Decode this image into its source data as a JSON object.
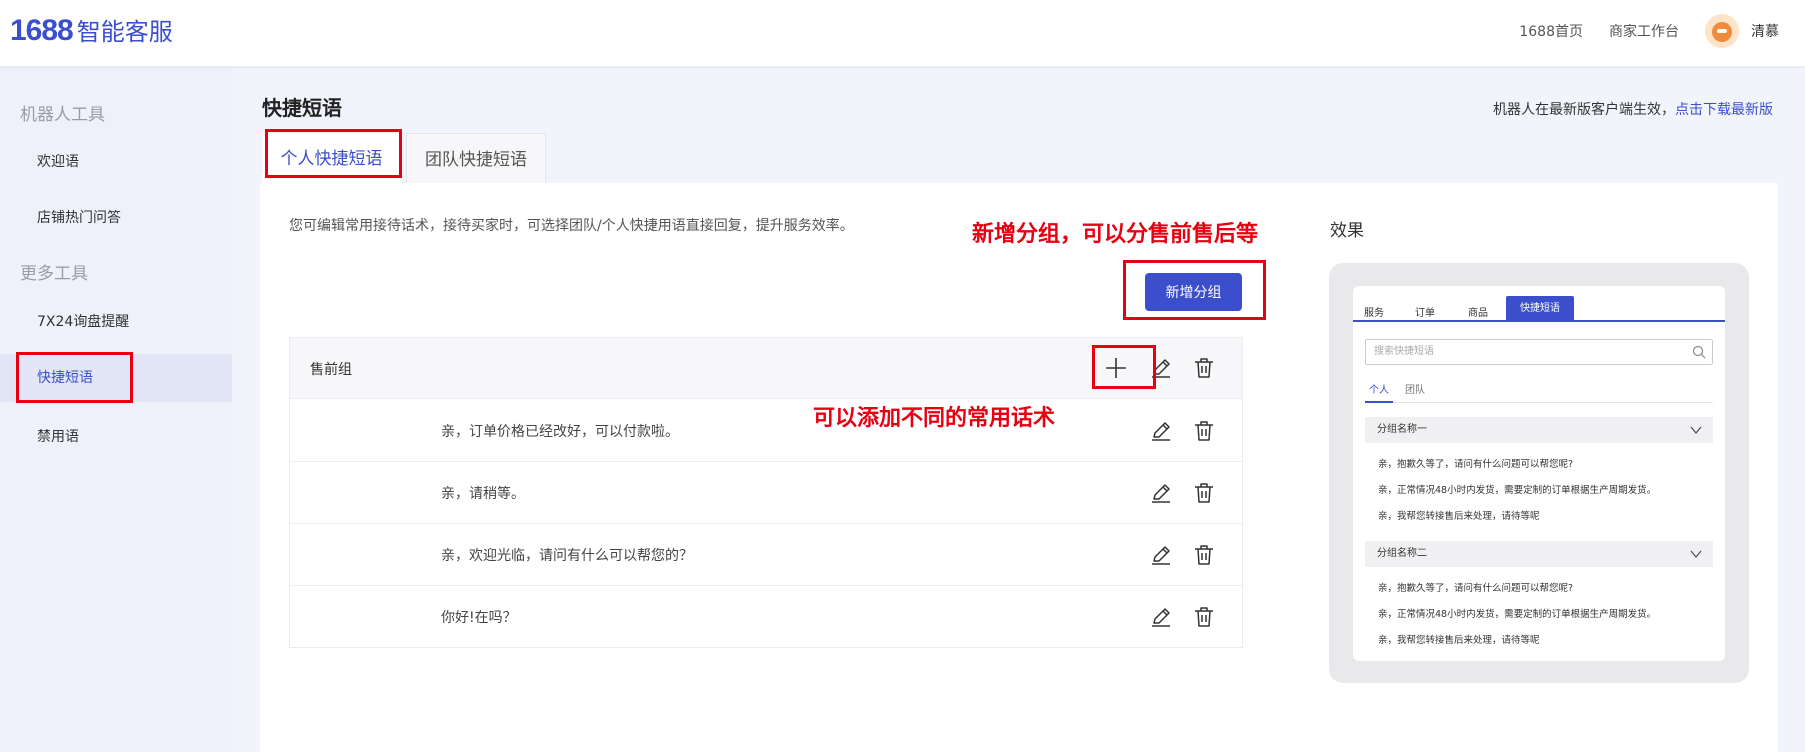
{
  "header": {
    "logo_num": "1688",
    "logo_text": "智能客服",
    "nav": [
      "1688首页",
      "商家工作台"
    ],
    "user_name": "清慕"
  },
  "sidebar": {
    "group1": "机器人工具",
    "group2": "更多工具",
    "items": [
      "欢迎语",
      "店铺热门问答",
      "7X24询盘提醒",
      "快捷短语",
      "禁用语"
    ]
  },
  "main": {
    "title": "快捷短语",
    "notice_text": "机器人在最新版客户端生效，",
    "notice_link": "点击下载最新版",
    "tabs": [
      "个人快捷短语",
      "团队快捷短语"
    ],
    "description": "您可编辑常用接待话术，接待买家时，可选择团队/个人快捷用语直接回复，提升服务效率。",
    "add_group_button": "新增分组",
    "group_name": "售前组",
    "rows": [
      "亲，订单价格已经改好，可以付款啦。",
      "亲，请稍等。",
      "亲，欢迎光临，请问有什么可以帮您的？",
      "你好!在吗？"
    ]
  },
  "preview": {
    "label": "效果",
    "tabs": [
      "服务",
      "订单",
      "商品",
      "快捷短语"
    ],
    "search_placeholder": "搜索快捷短语",
    "subtabs": [
      "个人",
      "团队"
    ],
    "group1": "分组名称一",
    "group1_items": [
      "亲，抱歉久等了，请问有什么问题可以帮您呢?",
      "亲，正常情况48小时内发货，需要定制的订单根据生产周期发货。",
      "亲，我帮您转接售后来处理，请待等呢"
    ],
    "group2": "分组名称二",
    "group2_items": [
      "亲，抱歉久等了，请问有什么问题可以帮您呢?",
      "亲，正常情况48小时内发货，需要定制的订单根据生产周期发货。",
      "亲，我帮您转接售后来处理，请待等呢"
    ]
  },
  "annotations": {
    "add_group_note": "新增分组，可以分售前售后等",
    "add_phrase_note": "可以添加不同的常用话术"
  }
}
